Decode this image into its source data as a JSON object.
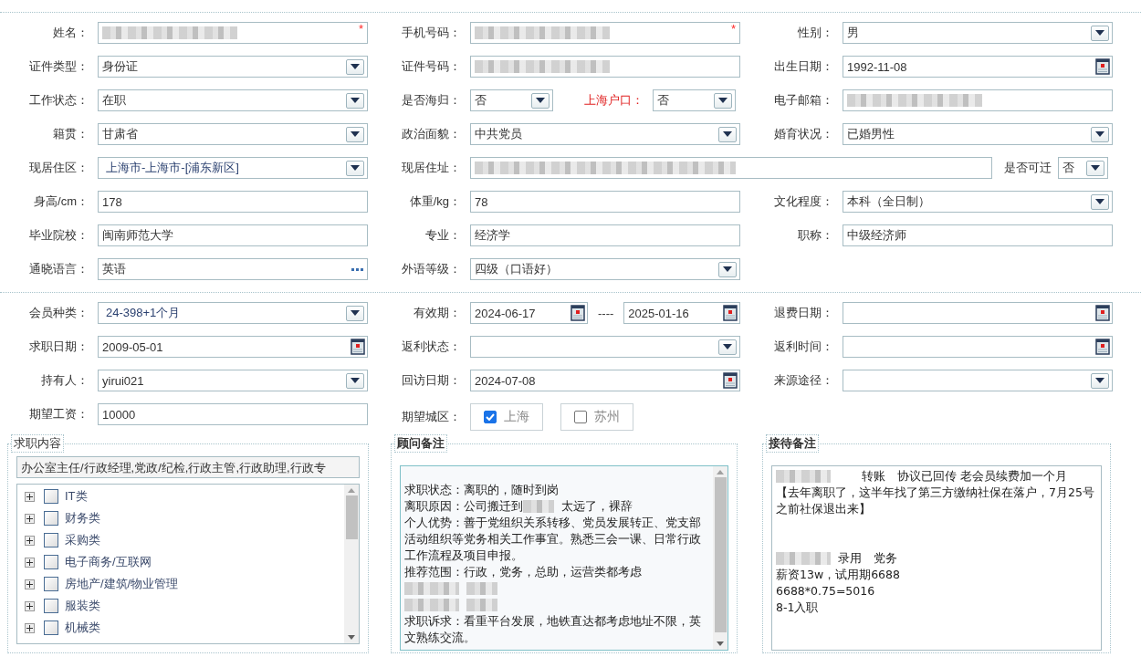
{
  "section_1": {
    "rows": [
      [
        {
          "kind": "field",
          "label": "姓名：",
          "field": {
            "kind": "text",
            "redacted": true,
            "required_mark": "*"
          }
        },
        {
          "kind": "field",
          "label": "手机号码：",
          "field": {
            "kind": "text",
            "redacted": true,
            "required_mark": "*"
          }
        },
        {
          "kind": "field",
          "label": "性别：",
          "field": {
            "kind": "select",
            "value": "男"
          }
        }
      ],
      [
        {
          "kind": "field",
          "label": "证件类型：",
          "field": {
            "kind": "select",
            "value": "身份证"
          }
        },
        {
          "kind": "field",
          "label": "证件号码：",
          "field": {
            "kind": "text",
            "redacted": true
          }
        },
        {
          "kind": "field",
          "label": "出生日期：",
          "field": {
            "kind": "date",
            "value": "1992-11-08"
          }
        }
      ],
      [
        {
          "kind": "field",
          "label": "工作状态：",
          "field": {
            "kind": "select",
            "value": "在职"
          }
        },
        {
          "kind": "split",
          "label": "是否海归：",
          "field": {
            "kind": "select",
            "value": "否"
          },
          "second_label": "上海户口：",
          "second_emphasis": true,
          "second_field": {
            "kind": "select",
            "value": "否"
          }
        },
        {
          "kind": "field",
          "label": "电子邮箱：",
          "field": {
            "kind": "text",
            "redacted": true
          }
        }
      ],
      [
        {
          "kind": "field",
          "label": "籍贯：",
          "field": {
            "kind": "select",
            "value": "甘肃省"
          }
        },
        {
          "kind": "field",
          "label": "政治面貌：",
          "field": {
            "kind": "select",
            "value": "中共党员"
          }
        },
        {
          "kind": "field",
          "label": "婚育状况：",
          "field": {
            "kind": "select",
            "value": "已婚男性"
          }
        }
      ],
      [
        {
          "kind": "field",
          "label": "现居住区：",
          "field": {
            "kind": "select",
            "value": "上海市-上海市-[浦东新区]",
            "accent": true
          }
        },
        {
          "kind": "address",
          "label": "现居住址：",
          "field": {
            "kind": "text",
            "redacted": true
          },
          "second_label": "是否可迁",
          "second_field": {
            "kind": "select",
            "value": "否"
          }
        }
      ],
      [
        {
          "kind": "field",
          "label": "身高/cm：",
          "field": {
            "kind": "text",
            "value": "178"
          }
        },
        {
          "kind": "field",
          "label": "体重/kg：",
          "field": {
            "kind": "text",
            "value": "78"
          }
        },
        {
          "kind": "field",
          "label": "文化程度：",
          "field": {
            "kind": "select",
            "value": "本科（全日制）"
          }
        }
      ],
      [
        {
          "kind": "field",
          "label": "毕业院校：",
          "field": {
            "kind": "text",
            "value": "闽南师范大学"
          }
        },
        {
          "kind": "field",
          "label": "专业：",
          "field": {
            "kind": "text",
            "value": "经济学"
          }
        },
        {
          "kind": "field",
          "label": "职称：",
          "field": {
            "kind": "text",
            "value": "中级经济师"
          }
        }
      ],
      [
        {
          "kind": "field",
          "label": "通晓语言：",
          "field": {
            "kind": "lookup",
            "value": "英语"
          }
        },
        {
          "kind": "field",
          "label": "外语等级：",
          "field": {
            "kind": "select",
            "value": "四级（口语好）"
          }
        }
      ]
    ]
  },
  "section_2": {
    "rows": [
      [
        {
          "kind": "field",
          "label": "会员种类：",
          "field": {
            "kind": "select",
            "value": "24-398+1个月",
            "accent": true
          }
        },
        {
          "kind": "range",
          "label": "有效期：",
          "field": {
            "kind": "date",
            "value": "2024-06-17"
          },
          "separator": "----",
          "second_field": {
            "kind": "date",
            "value": "2025-01-16"
          }
        },
        {
          "kind": "field",
          "label": "退费日期：",
          "field": {
            "kind": "date"
          }
        }
      ],
      [
        {
          "kind": "field",
          "label": "求职日期：",
          "field": {
            "kind": "date",
            "value": "2009-05-01"
          }
        },
        {
          "kind": "field",
          "label": "返利状态：",
          "field": {
            "kind": "select"
          }
        },
        {
          "kind": "field",
          "label": "返利时间：",
          "field": {
            "kind": "date"
          }
        }
      ],
      [
        {
          "kind": "field",
          "label": "持有人：",
          "field": {
            "kind": "select",
            "value": "yirui021"
          }
        },
        {
          "kind": "field",
          "label": "回访日期：",
          "field": {
            "kind": "date",
            "value": "2024-07-08"
          }
        },
        {
          "kind": "field",
          "label": "来源途径：",
          "field": {
            "kind": "select"
          }
        }
      ],
      [
        {
          "kind": "field",
          "label": "期望工资：",
          "field": {
            "kind": "text",
            "value": "10000"
          }
        },
        {
          "kind": "chips",
          "label": "期望城区：",
          "options": [
            {
              "label": "上海",
              "checked": true
            },
            {
              "label": "苏州",
              "checked": false
            }
          ]
        }
      ]
    ]
  },
  "job_intent": {
    "legend": "求职内容",
    "selection": "办公室主任/行政经理,党政/纪检,行政主管,行政助理,行政专",
    "categories": [
      {
        "label": "IT类",
        "checked": false,
        "expanded": false
      },
      {
        "label": "财务类",
        "checked": false,
        "expanded": false
      },
      {
        "label": "采购类",
        "checked": false,
        "expanded": false
      },
      {
        "label": "电子商务/互联网",
        "checked": false,
        "expanded": false
      },
      {
        "label": "房地产/建筑/物业管理",
        "checked": false,
        "expanded": false
      },
      {
        "label": "服装类",
        "checked": false,
        "expanded": false
      },
      {
        "label": "机械类",
        "checked": false,
        "expanded": false
      }
    ]
  },
  "advisor_notes": {
    "legend": "顾问备注",
    "blocks": [
      [
        {
          "parts": [
            {
              "kind": "text",
              "text": "求职状态：离职的，随时到岗"
            }
          ]
        },
        {
          "parts": [
            {
              "kind": "text",
              "text": "离职原因：公司搬迁到"
            },
            {
              "kind": "redacted"
            },
            {
              "kind": "text",
              "text": " 太远了，裸辞"
            }
          ]
        },
        {
          "parts": [
            {
              "kind": "text",
              "text": "个人优势：善于党组织关系转移、党员发展转正、党支部活动组织等党务相关工作事宜。熟悉三会一课、日常行政工作流程及项目申报。"
            }
          ]
        },
        {
          "parts": [
            {
              "kind": "text",
              "text": "推荐范围：行政，党务，总助，运营类都考虑"
            }
          ]
        },
        {
          "parts": [
            {
              "kind": "redacted"
            },
            {
              "kind": "redacted"
            }
          ]
        },
        {
          "parts": [
            {
              "kind": "redacted"
            },
            {
              "kind": "redacted"
            }
          ]
        },
        {
          "parts": [
            {
              "kind": "text",
              "text": "求职诉求：看重平台发展，地铁直达都考虑地址不限，英文熟练交流。"
            }
          ]
        }
      ]
    ]
  },
  "reception_notes": {
    "legend": "接待备注",
    "blocks": [
      [
        {
          "parts": [
            {
              "kind": "redacted"
            },
            {
              "kind": "text",
              "text": "　　转账　协议已回传 老会员续费加一个月"
            }
          ]
        },
        {
          "parts": [
            {
              "kind": "text",
              "text": "【去年离职了，这半年找了第三方缴纳社保在落户，7月25号之前社保退出来】"
            }
          ]
        }
      ],
      [
        {
          "parts": [
            {
              "kind": "redacted"
            },
            {
              "kind": "text",
              "text": " 录用　党务"
            }
          ]
        },
        {
          "parts": [
            {
              "kind": "text",
              "text": "薪资13w，试用期6688"
            }
          ]
        },
        {
          "parts": [
            {
              "kind": "text",
              "text": "6688*0.75=5016"
            }
          ]
        },
        {
          "parts": [
            {
              "kind": "text",
              "text": "8-1入职"
            }
          ]
        }
      ]
    ]
  }
}
